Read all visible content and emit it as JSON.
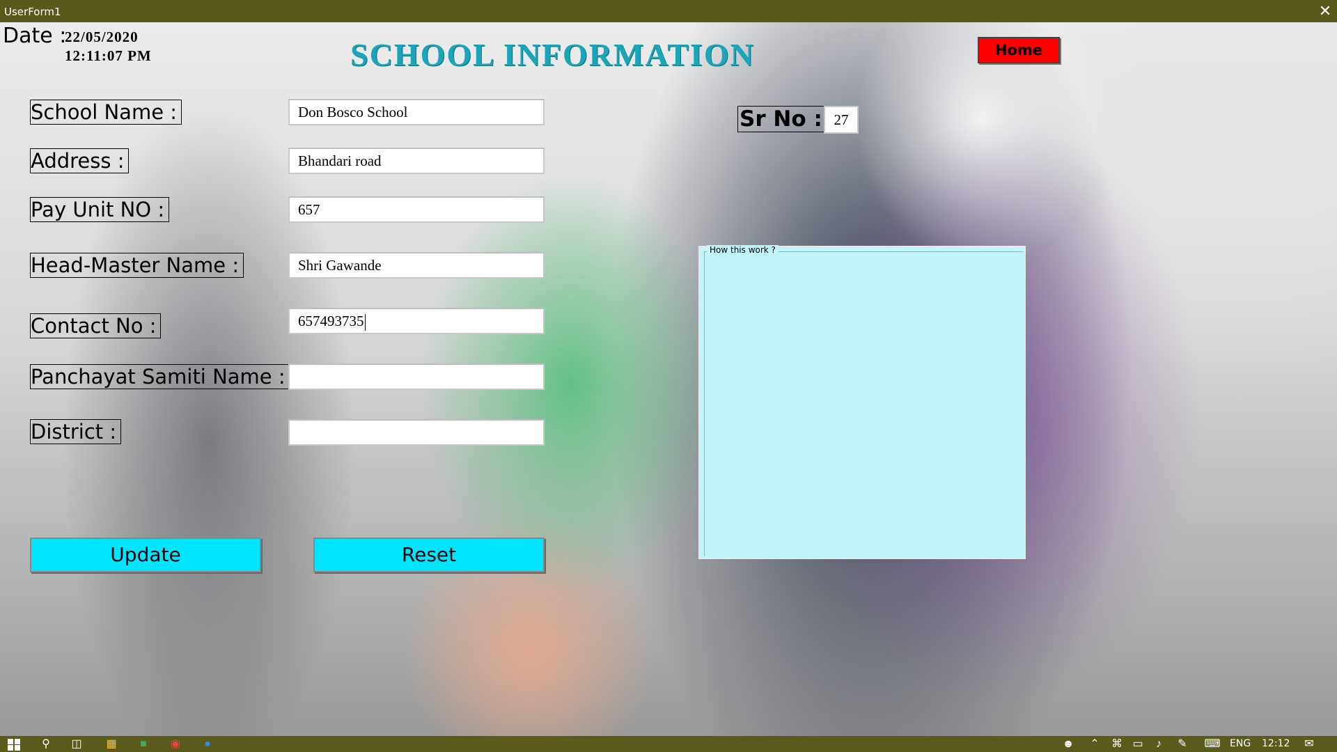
{
  "window": {
    "title": "UserForm1",
    "close_glyph": "✕"
  },
  "header": {
    "date_label": "Date :",
    "date_value": "22/05/2020",
    "time_value": "12:11:07 PM",
    "title": "SCHOOL INFORMATION",
    "home_label": "Home"
  },
  "form": {
    "fields": [
      {
        "label": "School Name :",
        "value": "Don Bosco School"
      },
      {
        "label": "Address :",
        "value": "Bhandari road"
      },
      {
        "label": "Pay Unit NO :",
        "value": "657"
      },
      {
        "label": "Head-Master Name :",
        "value": "Shri Gawande"
      },
      {
        "label": "Contact No :",
        "value": "657493735"
      },
      {
        "label": "Panchayat Samiti Name :",
        "value": ""
      },
      {
        "label": "District :",
        "value": ""
      }
    ],
    "srno": {
      "label": "Sr No :",
      "value": "27"
    },
    "help": {
      "legend": "How this work ?"
    },
    "buttons": {
      "update": "Update",
      "reset": "Reset"
    }
  },
  "taskbar": {
    "icons": [
      "windows-icon",
      "search-icon",
      "task-view-icon",
      "file-explorer-icon",
      "excel-icon",
      "chrome-icon",
      "zoom-icon"
    ],
    "tray_icons": [
      "people-icon",
      "chevron-up-icon",
      "network-icon",
      "battery-icon",
      "volume-icon",
      "pen-icon",
      "keyboard-icon"
    ],
    "language": "ENG",
    "clock": "12:12",
    "notification_icon": "notification-icon"
  },
  "colors": {
    "title_bar": "#585a1c",
    "page_title": "#1aa6b8",
    "home_button": "#ff0000",
    "action_button": "#00e5ff",
    "help_panel": "#bff5fb"
  }
}
